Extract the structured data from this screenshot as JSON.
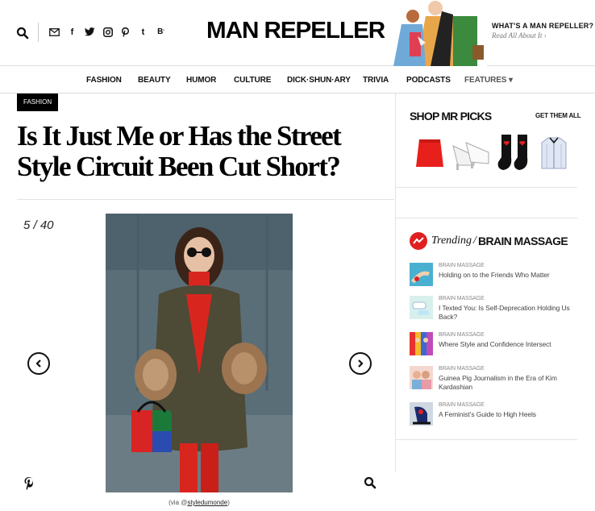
{
  "header": {
    "logo": "MAN REPELLER",
    "about_title": "WHAT'S A MAN REPELLER?",
    "about_link": "Read All About It ›",
    "social": [
      "mail-icon",
      "facebook-icon",
      "twitter-icon",
      "instagram-icon",
      "pinterest-icon",
      "tumblr-icon",
      "bloglovin-icon"
    ]
  },
  "nav": {
    "items": [
      "FASHION",
      "BEAUTY",
      "HUMOR",
      "CULTURE",
      "DICK·SHUN·ARY",
      "TRIVIA",
      "PODCASTS",
      "FEATURES ▾"
    ]
  },
  "article": {
    "category": "FASHION",
    "title": "Is It Just Me or Has the Street Style Circuit Been Cut Short?",
    "counter": "5 / 40",
    "credit_prefix": "(via @",
    "credit_handle": "styledumonde",
    "credit_suffix": ")"
  },
  "shop": {
    "title": "SHOP MR PICKS",
    "link": "GET THEM ALL",
    "items": [
      "red-skirt",
      "white-mules",
      "heart-socks",
      "striped-shirt"
    ]
  },
  "trending": {
    "label": "Trending",
    "slash": "/",
    "category": "BRAIN MASSAGE",
    "items": [
      {
        "category": "BRAIN MASSAGE",
        "title": "Holding on to the Friends Who Matter"
      },
      {
        "category": "BRAIN MASSAGE",
        "title": "I Texted You: Is Self-Deprecation Holding Us Back?"
      },
      {
        "category": "BRAIN MASSAGE",
        "title": "Where Style and Confidence Intersect"
      },
      {
        "category": "BRAIN MASSAGE",
        "title": "Guinea Pig Journalism in the Era of Kim Kardashian"
      },
      {
        "category": "BRAIN MASSAGE",
        "title": "A Feminist’s Guide to High Heels"
      }
    ]
  },
  "colors": {
    "accent": "#e02020",
    "text": "#111111",
    "muted": "#888888",
    "divider": "#e3e3e3"
  }
}
